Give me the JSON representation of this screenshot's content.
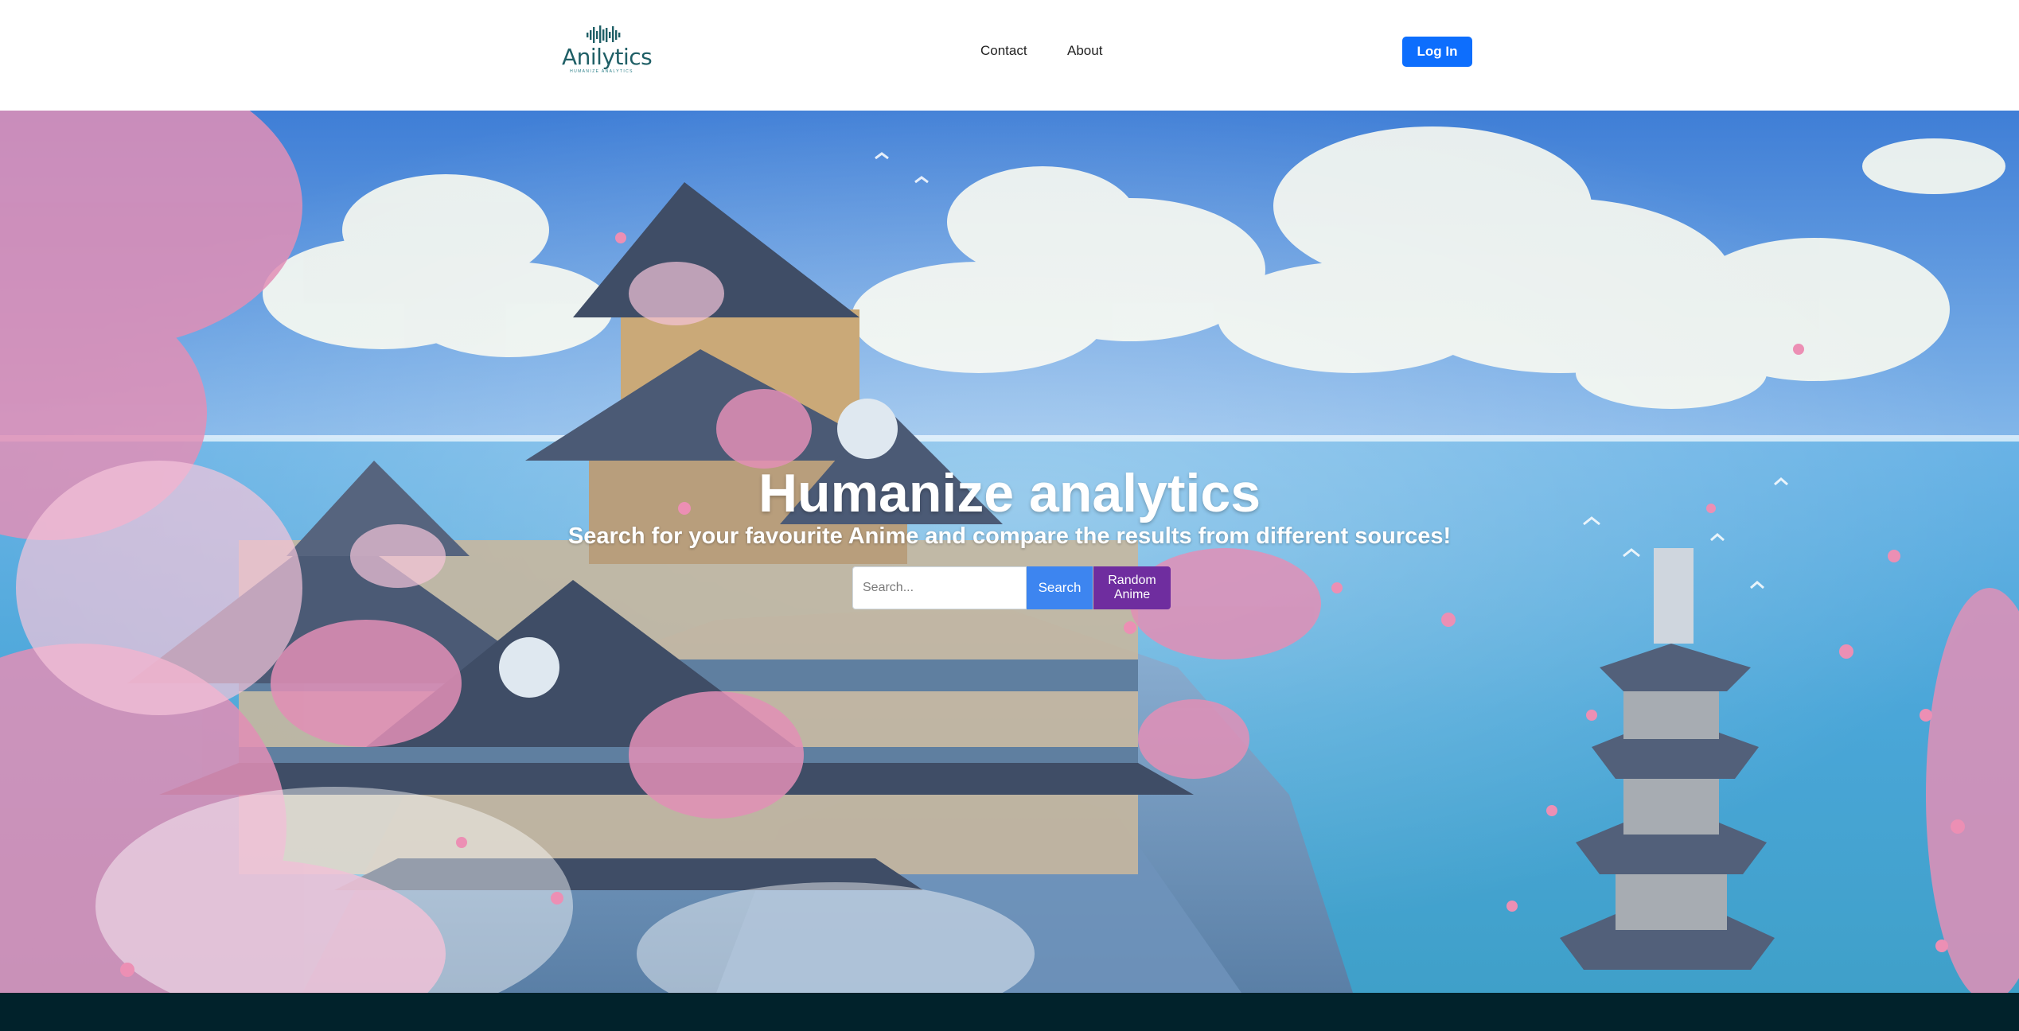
{
  "brand": {
    "name": "Anilytics",
    "tagline": "HUMANIZE ANALYTICS",
    "color": "#1f5f66"
  },
  "nav": {
    "items": [
      {
        "label": "Contact"
      },
      {
        "label": "About"
      }
    ],
    "login_label": "Log In",
    "login_color": "#0d6efd"
  },
  "hero": {
    "title": "Humanize analytics",
    "subtitle": "Search for your favourite Anime and compare the results from different sources!",
    "search": {
      "placeholder": "Search...",
      "value": "",
      "button_label": "Search",
      "button_color": "#3d85f0"
    },
    "random_button": {
      "label": "Random Anime",
      "color": "#6f2d9f"
    }
  },
  "footer": {
    "color": "#01222b"
  }
}
